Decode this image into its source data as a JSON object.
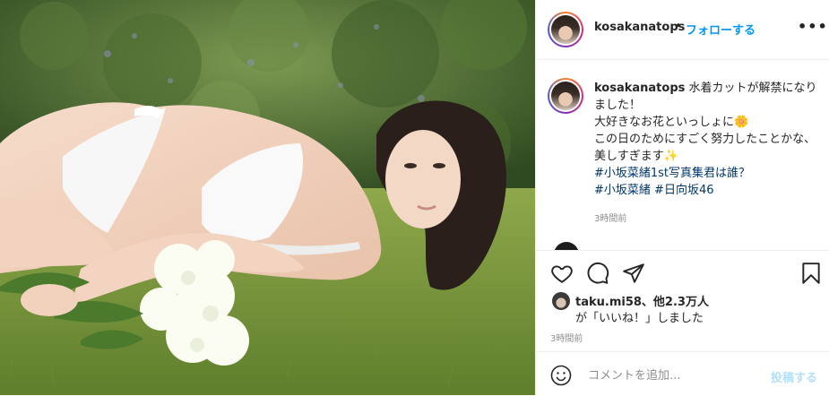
{
  "header": {
    "username": "kosakanatops",
    "dot": "•",
    "follow_label": "フォローする",
    "more_label": "•••"
  },
  "caption": {
    "username": "kosakanatops",
    "text": "水着カットが解禁になりました！\n大好きなお花といっしょに🌼\nこの日のためにすごく努力したことかな、美しすぎます✨\n",
    "hashtags_line1": "#小坂菜緒1st写真集君は誰？",
    "hashtags_line2a": "#小坂菜緒",
    "hashtags_line2b": "#日向坂46",
    "time": "3時間前"
  },
  "likes": {
    "liker": "taku.mi58",
    "others": "、他2.3万人",
    "suffix": "が「いいね！」しました"
  },
  "post_time": "3時間前",
  "comment": {
    "placeholder": "コメントを追加...",
    "post_label": "投稿する"
  },
  "colors": {
    "follow": "#0095f6",
    "hashtag": "#00376b",
    "post_button": "#b2dffc",
    "muted": "#8e8e8e"
  },
  "icons": [
    "heart-icon",
    "comment-icon",
    "share-icon",
    "bookmark-icon",
    "emoji-icon",
    "more-icon"
  ]
}
